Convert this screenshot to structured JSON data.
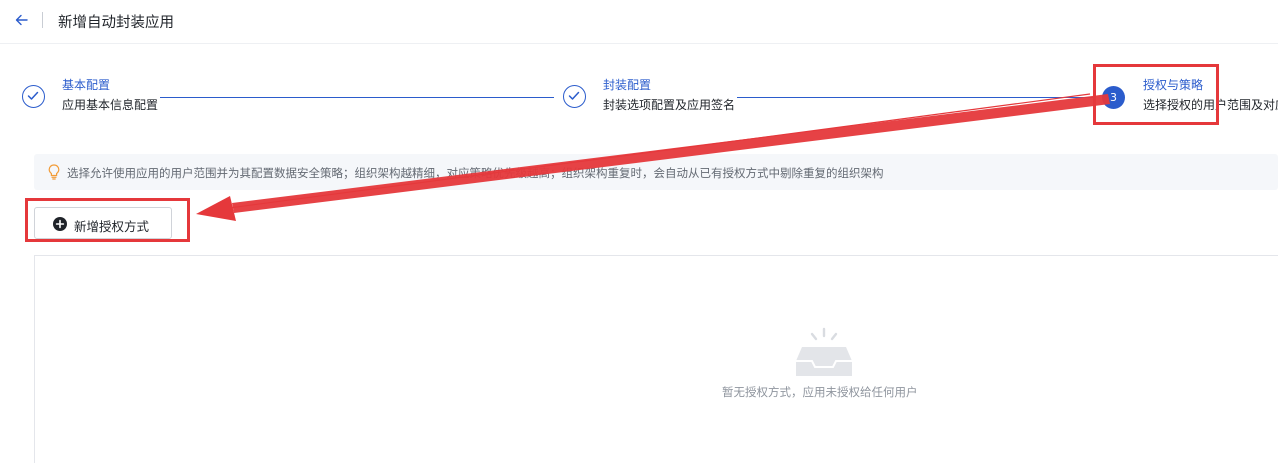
{
  "header": {
    "title": "新增自动封装应用",
    "back_icon": "arrow-left-icon"
  },
  "steps": [
    {
      "title": "基本配置",
      "description": "应用基本信息配置",
      "status": "done"
    },
    {
      "title": "封装配置",
      "description": "封装选项配置及应用签名",
      "status": "done"
    },
    {
      "number": "3",
      "title": "授权与策略",
      "description": "选择授权的用户范围及对应",
      "status": "active"
    }
  ],
  "info": {
    "icon": "lightbulb-icon",
    "text": "选择允许使用应用的用户范围并为其配置数据安全策略；组织架构越精细，对应策略优先级越高；组织架构重复时，会自动从已有授权方式中剔除重复的组织架构"
  },
  "add_auth_button": {
    "label": "新增授权方式",
    "icon": "plus-circle-icon"
  },
  "empty_state": {
    "icon": "empty-inbox-icon",
    "text": "暂无授权方式，应用未授权给任何用户"
  },
  "colors": {
    "accent": "#2b5ccc",
    "annotation": "#e5383b"
  }
}
